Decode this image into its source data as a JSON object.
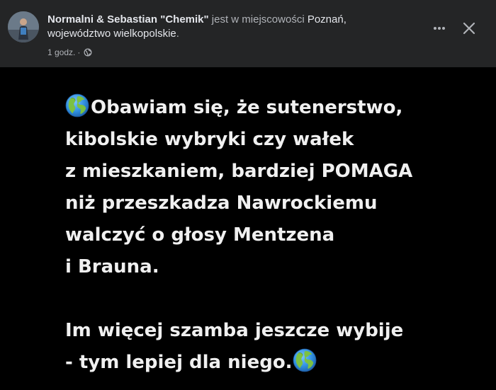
{
  "header": {
    "author": "Normalni & Sebastian \"Chemik\"",
    "checkin_text": " jest w miejscowości ",
    "location": "Poznań, województwo wielkopolskie",
    "location_suffix": ".",
    "time": "1 godz.",
    "separator": "·",
    "privacy_icon": "globe-icon",
    "more_icon": "more-dots-icon",
    "close_icon": "close-icon"
  },
  "post": {
    "lines_para1": [
      "Obawiam się, że sutenerstwo,",
      "kibolskie wybryki czy wałek",
      "z mieszkaniem, bardziej POMAGA",
      "niż przeszkadza Nawrockiemu",
      "walczyć o głosy Mentzena",
      "i Brauna."
    ],
    "lines_para2": [
      "Im więcej szamba jeszcze wybije",
      "- tym lepiej dla niego."
    ],
    "emoji": "globe-showing-americas-emoji"
  },
  "colors": {
    "header_bg": "#242526",
    "body_bg": "#000000",
    "primary_text": "#e4e6eb",
    "secondary_text": "#b0b3b8",
    "post_text": "#f0f0f0"
  }
}
